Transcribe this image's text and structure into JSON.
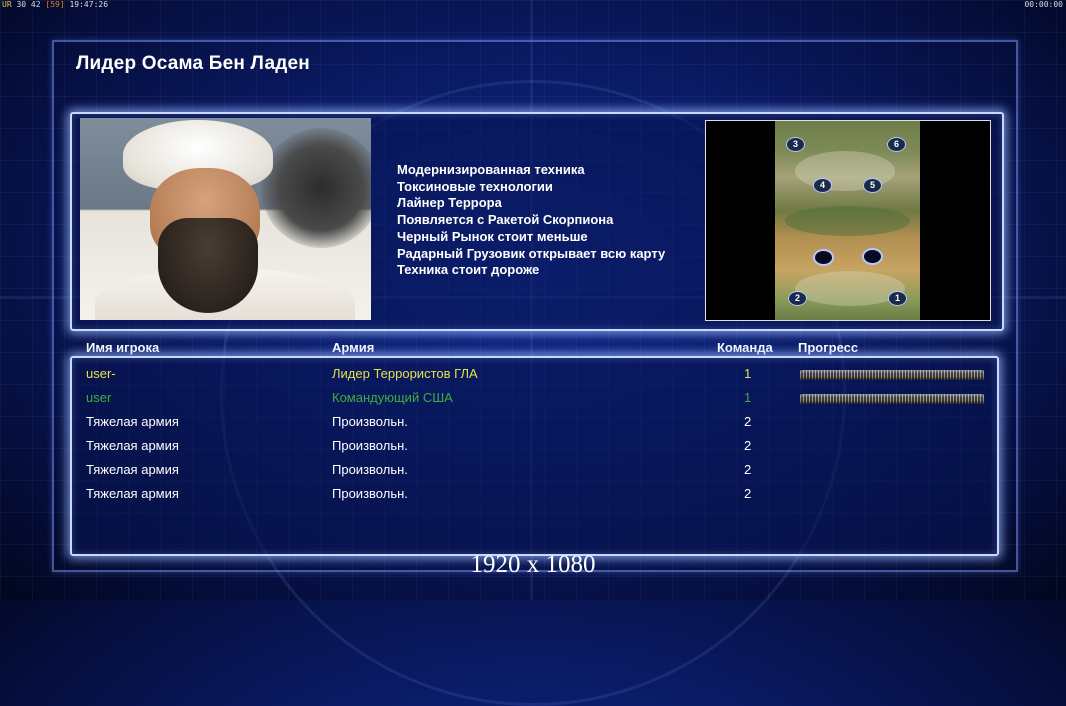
{
  "topbar": {
    "left_part1": "UR",
    "left_part2": "30 42",
    "left_part3": "[59]",
    "left_part4": "19:47:26",
    "right": "00:00:00"
  },
  "general": {
    "title": "Лидер Осама Бен Ладен",
    "features": [
      "Модернизированная техника",
      "Токсиновые технологии",
      "Лайнер Террора",
      "Появляется с Ракетой Скорпиона",
      "Черный Рынок стоит меньше",
      "Радарный Грузовик открывает всю карту",
      "Техника стоит дороже"
    ]
  },
  "map": {
    "slots": [
      "3",
      "6",
      "4",
      "5",
      "2",
      "1"
    ]
  },
  "table": {
    "headers": {
      "player": "Имя игрока",
      "army": "Армия",
      "team": "Команда",
      "progress": "Прогресс"
    },
    "rows": [
      {
        "player": "user-",
        "army": "Лидер Террористов ГЛА",
        "team": "1",
        "color": "#e8e04a",
        "progress": 1.0
      },
      {
        "player": "user",
        "army": "Командующий США",
        "team": "1",
        "color": "#3fae3a",
        "progress": 1.0
      },
      {
        "player": "Тяжелая армия",
        "army": "Произвольн.",
        "team": "2",
        "color": "#ffffff"
      },
      {
        "player": "Тяжелая армия",
        "army": "Произвольн.",
        "team": "2",
        "color": "#ffffff"
      },
      {
        "player": "Тяжелая армия",
        "army": "Произвольн.",
        "team": "2",
        "color": "#ffffff"
      },
      {
        "player": "Тяжелая армия",
        "army": "Произвольн.",
        "team": "2",
        "color": "#ffffff"
      }
    ]
  },
  "watermark": "1920 x 1080"
}
